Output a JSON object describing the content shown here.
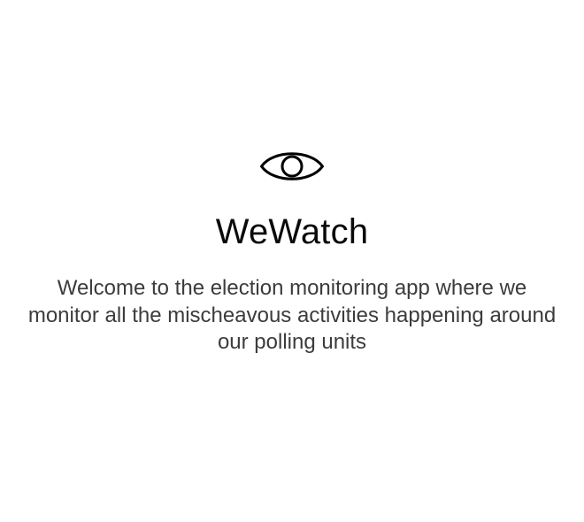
{
  "app": {
    "title": "WeWatch",
    "description": "Welcome to the election monitoring app where we monitor all the mischeavous activities happening around our polling units",
    "logo_icon": "eye-icon"
  },
  "colors": {
    "background": "#ffffff",
    "title": "#0a0a0a",
    "body_text": "#3c3c3c",
    "icon_stroke": "#000000"
  }
}
